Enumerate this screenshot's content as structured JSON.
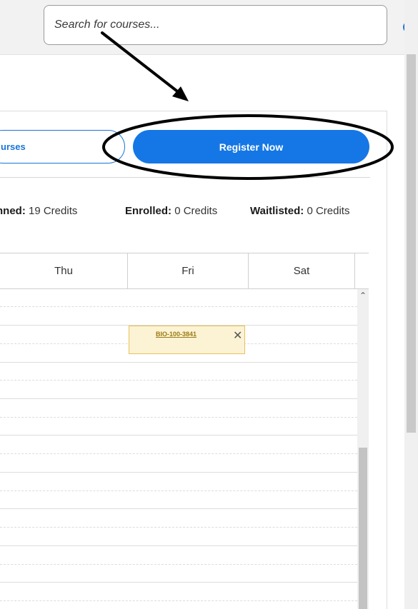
{
  "search": {
    "placeholder": "Search for courses...",
    "icon": "search-icon"
  },
  "actions": {
    "courses_label": "urses",
    "register_label": "Register Now"
  },
  "credits": {
    "planned_label": "nned:",
    "planned_value": "19 Credits",
    "enrolled_label": "Enrolled:",
    "enrolled_value": "0 Credits",
    "waitlisted_label": "Waitlisted:",
    "waitlisted_value": "0 Credits"
  },
  "calendar": {
    "days": [
      "Thu",
      "Fri",
      "Sat"
    ],
    "event": {
      "course_code": "BIO-100-3841",
      "close_icon": "close-icon"
    }
  },
  "colors": {
    "primary": "#1577e5",
    "event_bg": "#fcf3d5",
    "event_border": "#e6c25a",
    "event_text": "#9a7a10"
  }
}
